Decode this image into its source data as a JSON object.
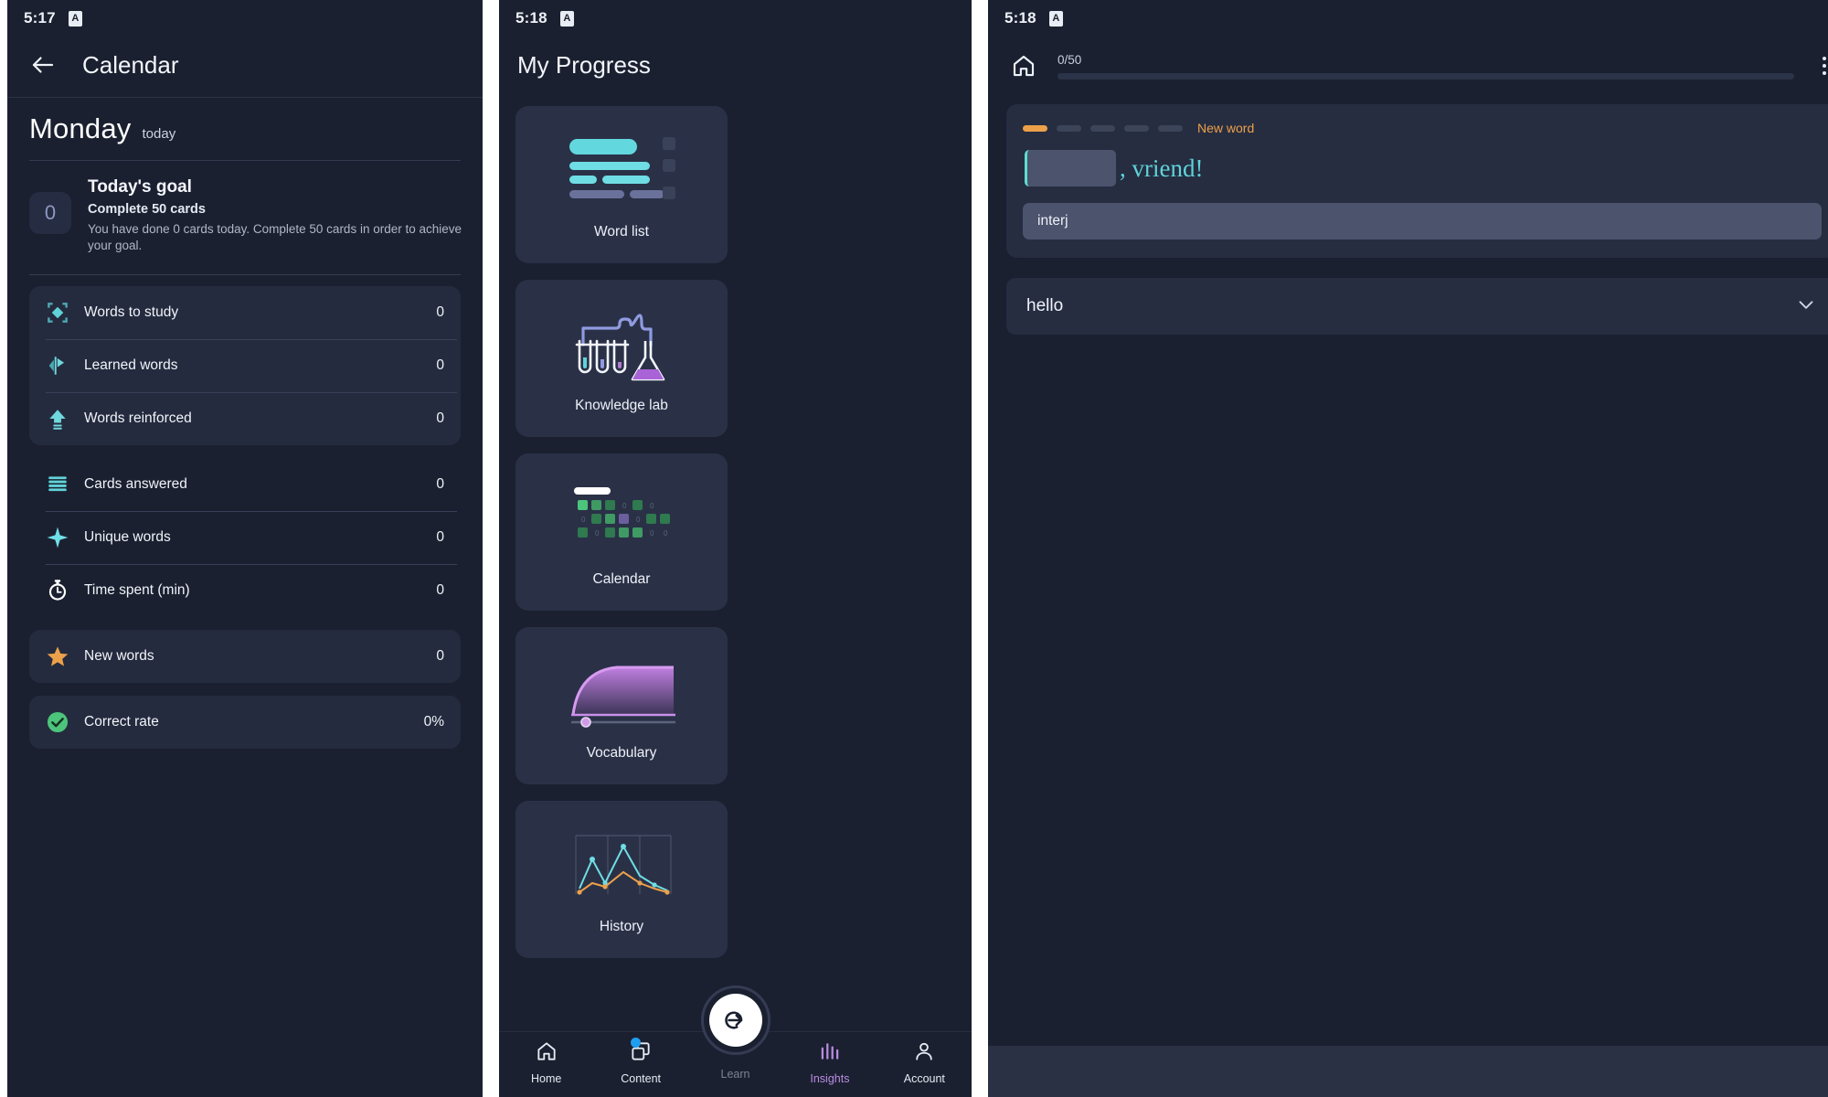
{
  "panel1": {
    "status": {
      "time": "5:17",
      "icon": "app-badge-icon"
    },
    "appbar": {
      "back_icon": "back-arrow-icon",
      "title": "Calendar"
    },
    "day": {
      "name": "Monday",
      "tag": "today"
    },
    "goal": {
      "badge_value": "0",
      "heading": "Today's goal",
      "subheading": "Complete 50 cards",
      "description": "You have done 0 cards today. Complete 50 cards in order to achieve your goal."
    },
    "groups": [
      {
        "style": "card",
        "rows": [
          {
            "icon": "diamond-target-icon",
            "label": "Words to study",
            "value": "0"
          },
          {
            "icon": "bar-flag-icon",
            "label": "Learned words",
            "value": "0"
          },
          {
            "icon": "arrow-up-reinforce-icon",
            "label": "Words reinforced",
            "value": "0"
          }
        ]
      },
      {
        "style": "flat",
        "rows": [
          {
            "icon": "lines-cards-icon",
            "label": "Cards answered",
            "value": "0"
          },
          {
            "icon": "sparkle-icon",
            "label": "Unique words",
            "value": "0"
          },
          {
            "icon": "stopwatch-icon",
            "label": "Time spent (min)",
            "value": "0"
          }
        ]
      },
      {
        "style": "card",
        "rows": [
          {
            "icon": "star-icon",
            "label": "New words",
            "value": "0"
          }
        ]
      },
      {
        "style": "card",
        "rows": [
          {
            "icon": "check-circle-icon",
            "label": "Correct rate",
            "value": "0%"
          }
        ]
      }
    ]
  },
  "panel2": {
    "status": {
      "time": "5:18",
      "icon": "app-badge-icon"
    },
    "title": "My Progress",
    "tiles": [
      {
        "label": "Word list",
        "art": "word-list-art"
      },
      {
        "label": "Knowledge lab",
        "art": "knowledge-lab-art"
      },
      {
        "label": "Calendar",
        "art": "calendar-heatmap-art"
      },
      {
        "label": "Vocabulary",
        "art": "vocabulary-curve-art"
      },
      {
        "label": "History",
        "art": "history-chart-art"
      }
    ],
    "nav": [
      {
        "label": "Home",
        "icon": "home-icon",
        "state": "normal",
        "badge": false
      },
      {
        "label": "Content",
        "icon": "layers-icon",
        "state": "normal",
        "badge": true
      },
      {
        "label": "Learn",
        "icon": "arrow-in-circle-icon",
        "state": "dim",
        "badge": false
      },
      {
        "label": "Insights",
        "icon": "bar-chart-icon",
        "state": "active",
        "badge": false
      },
      {
        "label": "Account",
        "icon": "person-icon",
        "state": "normal",
        "badge": false
      }
    ]
  },
  "panel3": {
    "status": {
      "time": "5:18",
      "icon": "app-badge-icon"
    },
    "appbar": {
      "home_icon": "home-icon",
      "progress_label": "0/50",
      "progress_percent": 0,
      "menu_icon": "kebab-menu-icon"
    },
    "card": {
      "steps_total": 5,
      "steps_done": 1,
      "step_text": "New word",
      "blank_placeholder": "",
      "sentence_rest": ", vriend!",
      "pos_value": "interj"
    },
    "answer": {
      "text": "hello",
      "chevron": "chevron-down-icon"
    }
  },
  "colors": {
    "panel_bg": "#1b2030",
    "card_bg": "#242b3e",
    "tile_bg": "#2a3147",
    "accent_teal": "#5fd3d8",
    "accent_orange": "#eda04a",
    "accent_purple": "#b98ce0",
    "accent_green": "#4cc47c",
    "badge_blue": "#1f9ef0"
  }
}
